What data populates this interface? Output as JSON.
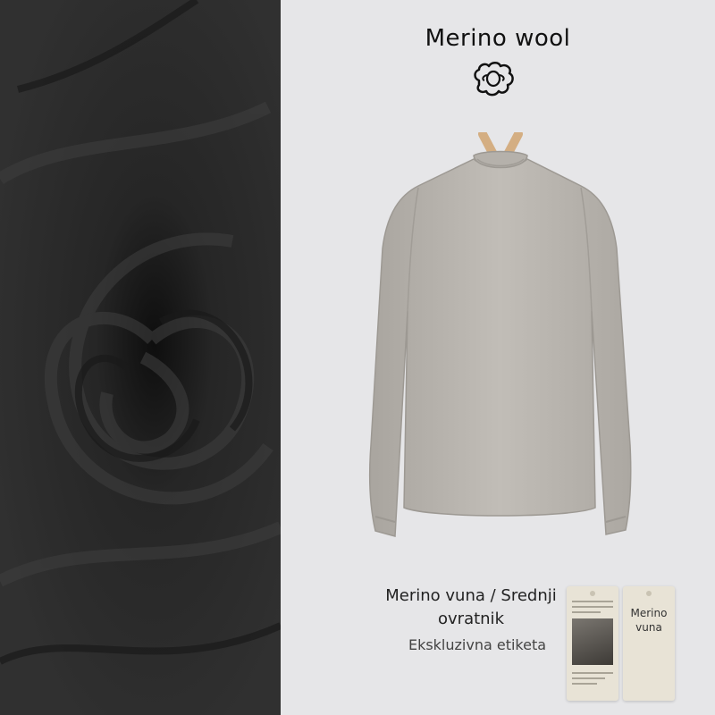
{
  "title": "Merino wool",
  "caption": {
    "main_line1": "Merino vuna / Srednji",
    "main_line2": "ovratnik",
    "sub": "Ekskluzivna etiketa"
  },
  "tag": {
    "line1": "Merino",
    "line2": "vuna"
  },
  "colors": {
    "background": "#e6e6e8",
    "fabric": "#2a2a2a",
    "shirt": "#b8b4ae",
    "hanger": "#d9b48a",
    "tag": "#e8e3d6"
  },
  "icons": [
    "sheep-icon"
  ]
}
